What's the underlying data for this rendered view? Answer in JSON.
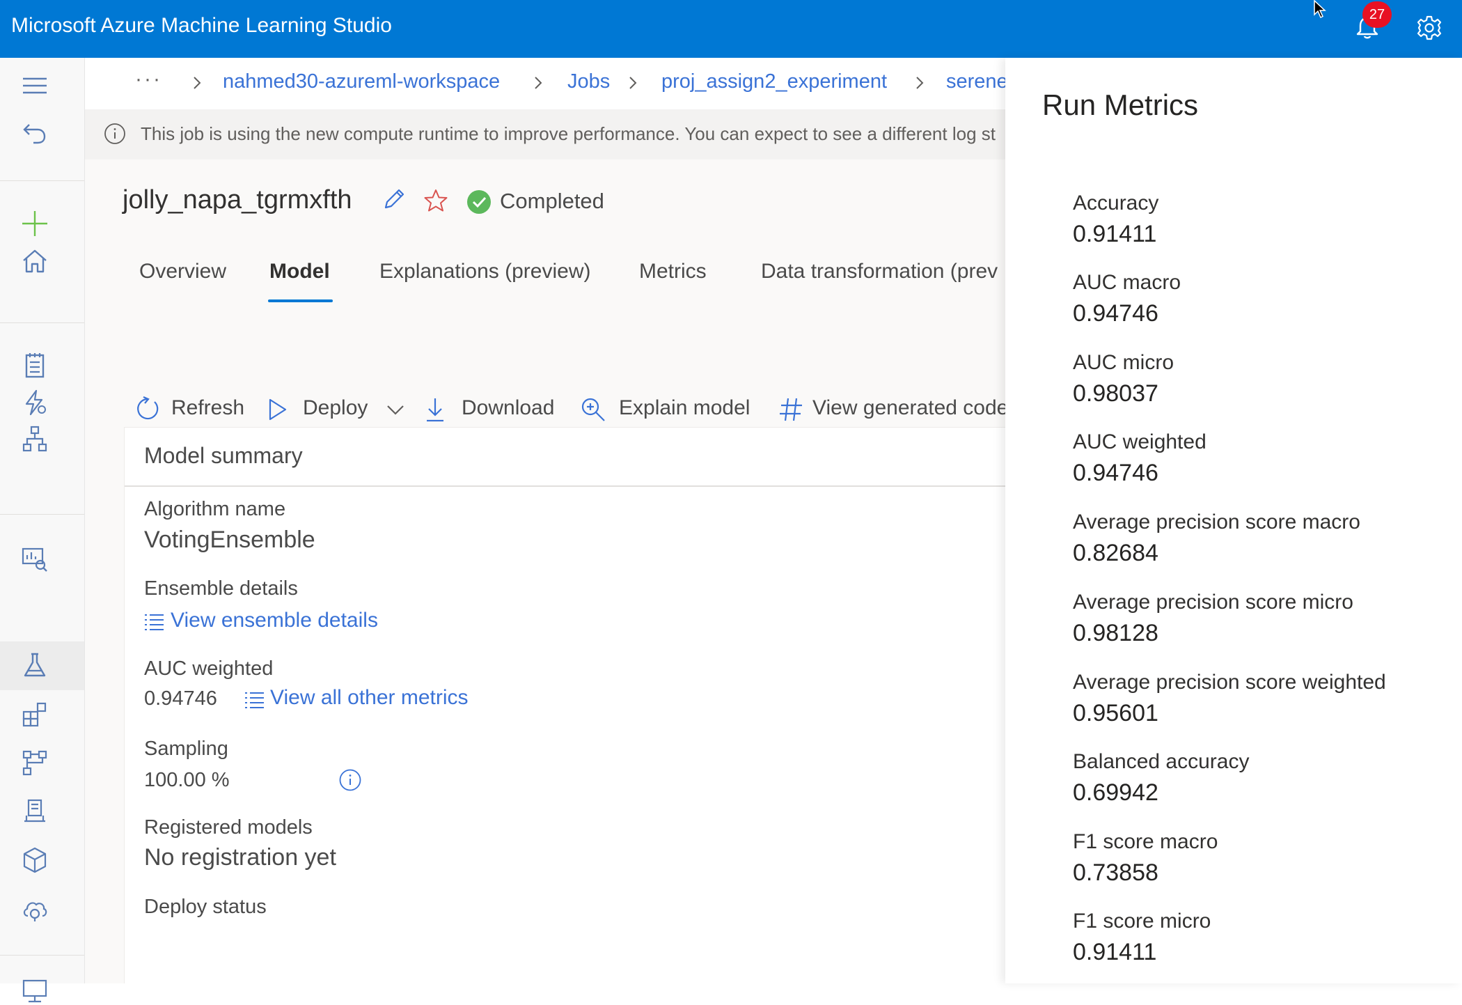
{
  "app": {
    "title": "Microsoft Azure Machine Learning Studio",
    "notification_count": "27"
  },
  "breadcrumb": {
    "ellipsis": "···",
    "items": [
      "nahmed30-azureml-workspace",
      "Jobs",
      "proj_assign2_experiment",
      "serene"
    ]
  },
  "info_bar": {
    "text": "This job is using the new compute runtime to improve performance. You can expect to see a different log st"
  },
  "job": {
    "name": "jolly_napa_tgrmxfth",
    "status": "Completed"
  },
  "tabs": [
    "Overview",
    "Model",
    "Explanations (preview)",
    "Metrics",
    "Data transformation (prev"
  ],
  "toolbar": {
    "refresh": "Refresh",
    "deploy": "Deploy",
    "download": "Download",
    "explain": "Explain model",
    "view_code": "View generated code"
  },
  "model_summary": {
    "title": "Model summary",
    "algorithm_label": "Algorithm name",
    "algorithm_value": "VotingEnsemble",
    "ensemble_label": "Ensemble details",
    "ensemble_link": "View ensemble details",
    "auc_label": "AUC weighted",
    "auc_value": "0.94746",
    "metrics_link": "View all other metrics",
    "sampling_label": "Sampling",
    "sampling_value": "100.00 %",
    "registered_label": "Registered models",
    "registered_value": "No registration yet",
    "deploy_label": "Deploy status"
  },
  "run_metrics": {
    "title": "Run Metrics",
    "items": [
      {
        "label": "Accuracy",
        "value": "0.91411"
      },
      {
        "label": "AUC macro",
        "value": "0.94746"
      },
      {
        "label": "AUC micro",
        "value": "0.98037"
      },
      {
        "label": "AUC weighted",
        "value": "0.94746"
      },
      {
        "label": "Average precision score macro",
        "value": "0.82684"
      },
      {
        "label": "Average precision score micro",
        "value": "0.98128"
      },
      {
        "label": "Average precision score weighted",
        "value": "0.95601"
      },
      {
        "label": "Balanced accuracy",
        "value": "0.69942"
      },
      {
        "label": "F1 score macro",
        "value": "0.73858"
      },
      {
        "label": "F1 score micro",
        "value": "0.91411"
      }
    ]
  },
  "colors": {
    "accent": "#0078d4",
    "link": "#3a72d6",
    "success": "#5cb85c",
    "star": "#d9534f",
    "badge": "#e81123"
  }
}
